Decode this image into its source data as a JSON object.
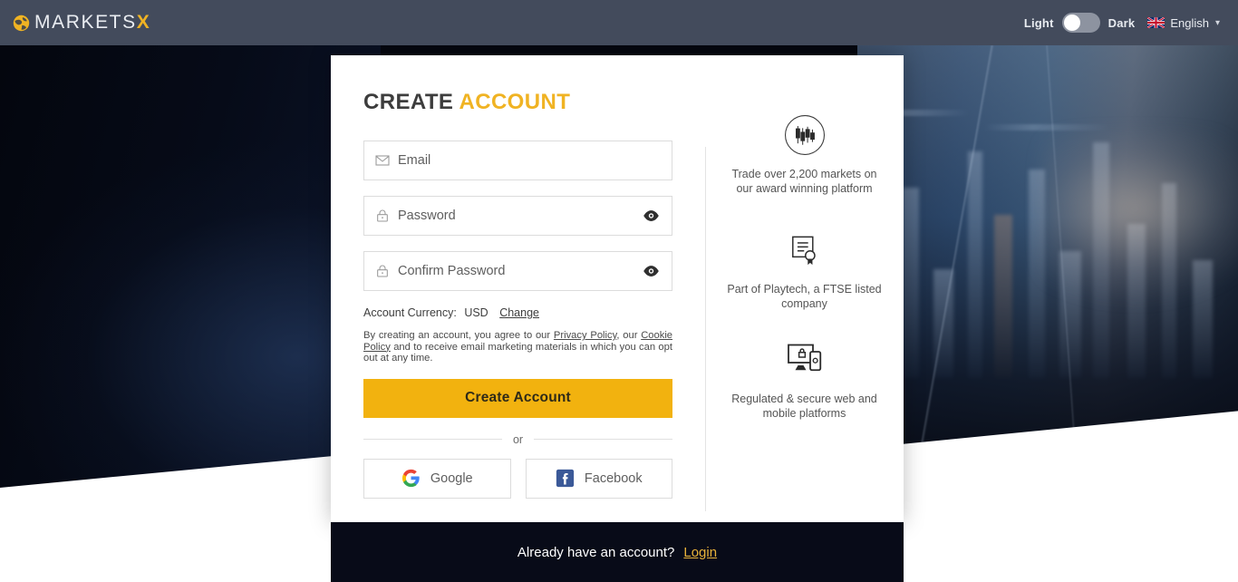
{
  "header": {
    "logo": {
      "icon": "globe-icon",
      "text_main": "MARKETS",
      "text_accent": "X"
    },
    "theme": {
      "light_label": "Light",
      "dark_label": "Dark",
      "active": "Light"
    },
    "language": {
      "flag": "uk-flag-icon",
      "label": "English",
      "chevron": "chevron-down-icon"
    }
  },
  "form": {
    "title_main": "CREATE",
    "title_accent": "ACCOUNT",
    "email": {
      "placeholder": "Email",
      "value": "",
      "icon": "envelope-icon"
    },
    "password": {
      "placeholder": "Password",
      "value": "",
      "icon": "lock-icon",
      "toggle_icon": "eye-icon"
    },
    "confirm_password": {
      "placeholder": "Confirm Password",
      "value": "",
      "icon": "lock-icon",
      "toggle_icon": "eye-icon"
    },
    "currency": {
      "label": "Account Currency:",
      "value": "USD",
      "change_label": "Change"
    },
    "legal": {
      "part1": "By creating an account, you agree to our ",
      "privacy_policy": "Privacy Policy",
      "part2": ", our ",
      "cookie_policy": "Cookie Policy",
      "part3": " and to receive email marketing materials in which you can opt out at any time."
    },
    "submit_label": "Create Account",
    "or_label": "or",
    "social": [
      {
        "name": "google",
        "label": "Google",
        "icon": "google-icon"
      },
      {
        "name": "facebook",
        "label": "Facebook",
        "icon": "facebook-icon"
      }
    ]
  },
  "benefits": [
    {
      "icon": "candlestick-chart-icon",
      "text": "Trade over 2,200 markets on our award winning platform"
    },
    {
      "icon": "certificate-icon",
      "text": "Part of Playtech, a FTSE listed company"
    },
    {
      "icon": "secure-devices-icon",
      "text": "Regulated & secure web and mobile platforms"
    }
  ],
  "footer": {
    "question": "Already have an account?",
    "login_label": "Login"
  },
  "colors": {
    "header_bg": "#434b5c",
    "accent_gold": "#f0b323",
    "cta_gold": "#f2b20f",
    "footer_bg": "#080b18",
    "card_bg": "#ffffff"
  }
}
